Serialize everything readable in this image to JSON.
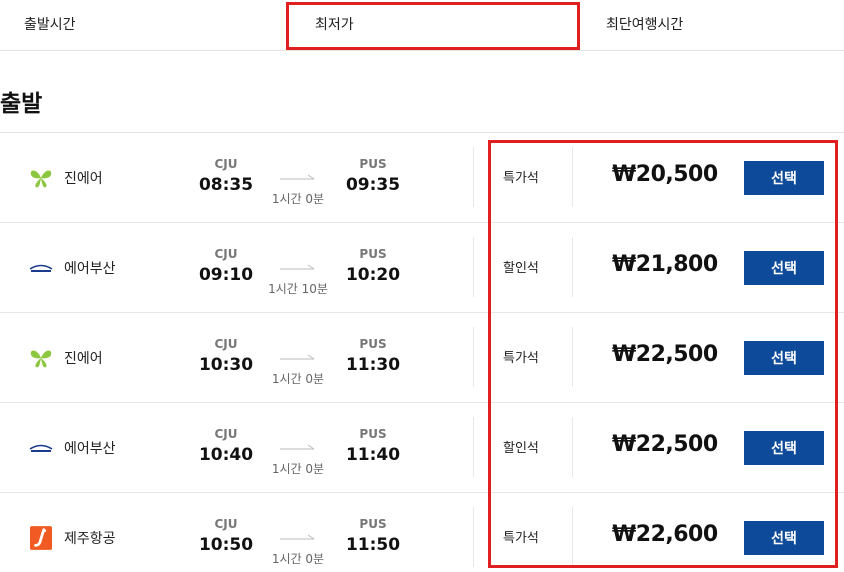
{
  "sort_tabs": {
    "departure_time": "출발시간",
    "lowest_price": "최저가",
    "shortest_duration": "최단여행시간"
  },
  "section_title": "출발",
  "colors": {
    "button": "#0e4a9a",
    "highlight": "#e02020",
    "jinair": "#8dc63f",
    "jejuair": "#f15a22",
    "airbusan": "#1b3c8c"
  },
  "flights": [
    {
      "airline": "진에어",
      "logo_icon": "jinair-butterfly-icon",
      "dep_code": "CJU",
      "dep_time": "08:35",
      "duration": "1시간 0분",
      "arr_code": "PUS",
      "arr_time": "09:35",
      "seat_class": "특가석",
      "price": "₩20,500",
      "select_label": "선택"
    },
    {
      "airline": "에어부산",
      "logo_icon": "airbusan-logo-icon",
      "dep_code": "CJU",
      "dep_time": "09:10",
      "duration": "1시간 10분",
      "arr_code": "PUS",
      "arr_time": "10:20",
      "seat_class": "할인석",
      "price": "₩21,800",
      "select_label": "선택"
    },
    {
      "airline": "진에어",
      "logo_icon": "jinair-butterfly-icon",
      "dep_code": "CJU",
      "dep_time": "10:30",
      "duration": "1시간 0분",
      "arr_code": "PUS",
      "arr_time": "11:30",
      "seat_class": "특가석",
      "price": "₩22,500",
      "select_label": "선택"
    },
    {
      "airline": "에어부산",
      "logo_icon": "airbusan-logo-icon",
      "dep_code": "CJU",
      "dep_time": "10:40",
      "duration": "1시간 0분",
      "arr_code": "PUS",
      "arr_time": "11:40",
      "seat_class": "할인석",
      "price": "₩22,500",
      "select_label": "선택"
    },
    {
      "airline": "제주항공",
      "logo_icon": "jejuair-logo-icon",
      "dep_code": "CJU",
      "dep_time": "10:50",
      "duration": "1시간 0분",
      "arr_code": "PUS",
      "arr_time": "11:50",
      "seat_class": "특가석",
      "price": "₩22,600",
      "select_label": "선택"
    }
  ]
}
